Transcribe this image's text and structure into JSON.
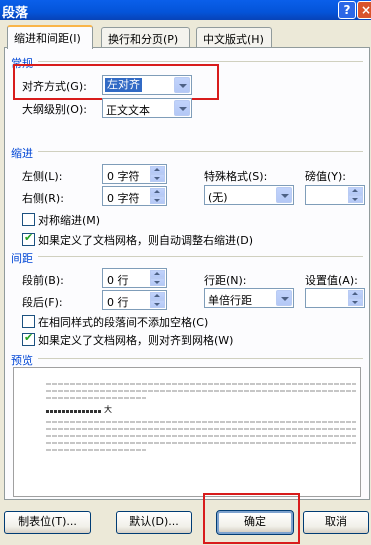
{
  "window": {
    "title": "段落",
    "help_glyph": "?",
    "close_glyph": "×"
  },
  "tabs": [
    {
      "label": "缩进和间距(I)"
    },
    {
      "label": "换行和分页(P)"
    },
    {
      "label": "中文版式(H)"
    }
  ],
  "general": {
    "title": "常规",
    "alignment_label": "对齐方式(G):",
    "alignment_value": "左对齐",
    "outline_label": "大纲级别(O):",
    "outline_value": "正文文本"
  },
  "indent": {
    "title": "缩进",
    "left_label": "左侧(L):",
    "left_value": "0 字符",
    "right_label": "右侧(R):",
    "right_value": "0 字符",
    "special_label": "特殊格式(S):",
    "special_value": "(无)",
    "by_label": "磅值(Y):",
    "by_value": "",
    "mirror_label": "对称缩进(M)",
    "mirror_checked": false,
    "auto_adjust_label": "如果定义了文档网格，则自动调整右缩进(D)",
    "auto_adjust_checked": true
  },
  "spacing": {
    "title": "间距",
    "before_label": "段前(B):",
    "before_value": "0 行",
    "after_label": "段后(F):",
    "after_value": "0 行",
    "line_label": "行距(N):",
    "line_value": "单倍行距",
    "at_label": "设置值(A):",
    "at_value": "",
    "no_space_label": "在相同样式的段落间不添加空格(C)",
    "no_space_checked": false,
    "snap_grid_label": "如果定义了文档网格，则对齐到网格(W)",
    "snap_grid_checked": true
  },
  "preview": {
    "title": "预览",
    "current_char": "大"
  },
  "buttons": {
    "tabs": "制表位(T)...",
    "default": "默认(D)...",
    "ok": "确定",
    "cancel": "取消"
  },
  "colors": {
    "accent_title": "#0046D5",
    "highlight": "#D81C1C",
    "selection": "#316AC5"
  }
}
